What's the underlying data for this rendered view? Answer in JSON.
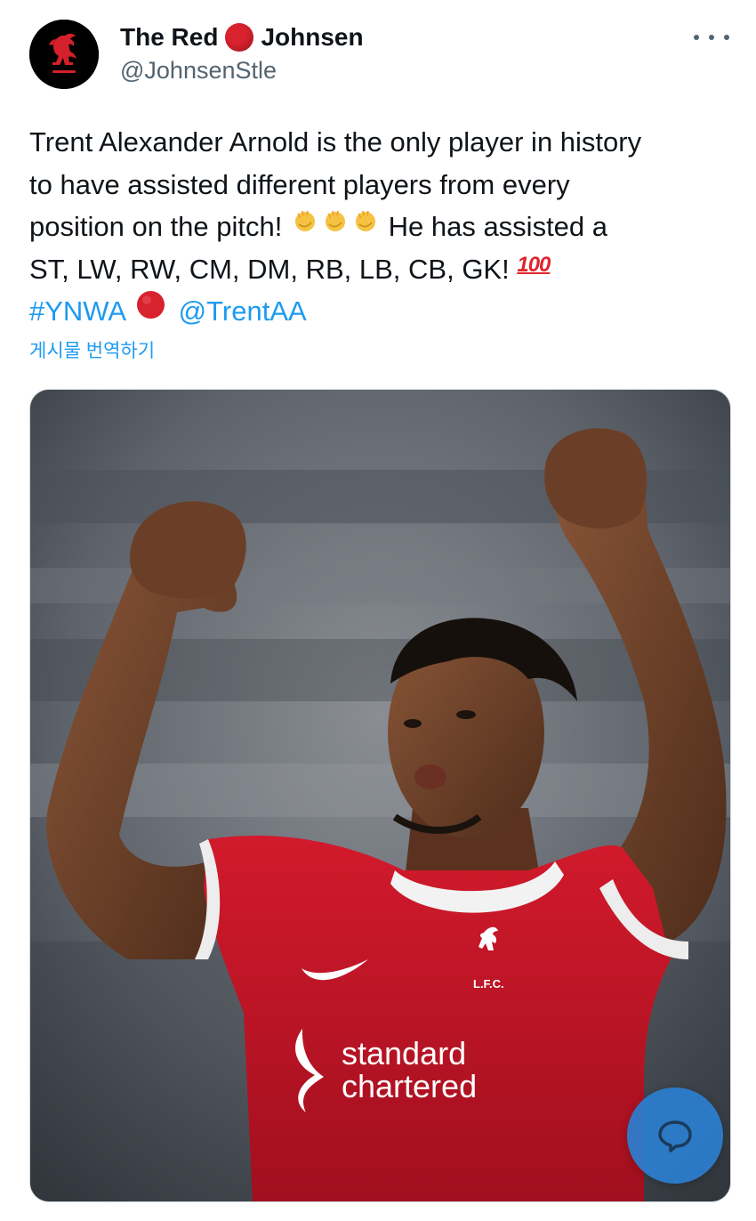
{
  "author": {
    "name_part1": "The Red",
    "name_part2": "Johnsen",
    "handle": "@JohnsenStle",
    "avatar_icon": "liverbird-icon"
  },
  "more_icon": "more-dots-icon",
  "tweet": {
    "line1": "Trent Alexander Arnold is the only player in history",
    "line2": "to have assisted different players from every",
    "line3_start": "position on the pitch!",
    "line3_end": "He has assisted a",
    "line4": "ST, LW, RW, CM, DM, RB, LB, CB, GK!",
    "hundred_emoji": "100",
    "hashtag": "#YNWA",
    "mention": "@TrentAA"
  },
  "translate_label": "게시물 번역하기",
  "media": {
    "sponsor_line1": "standard",
    "sponsor_line2": "chartered",
    "crest_text": "L.F.C."
  },
  "fab_icon": "reply-bubble-icon",
  "colors": {
    "link": "#1d9bf0",
    "secondary_text": "#536471",
    "red_circle": "#d8222d",
    "jersey_red": "#c8102e",
    "fab": "#2b7fd0"
  }
}
